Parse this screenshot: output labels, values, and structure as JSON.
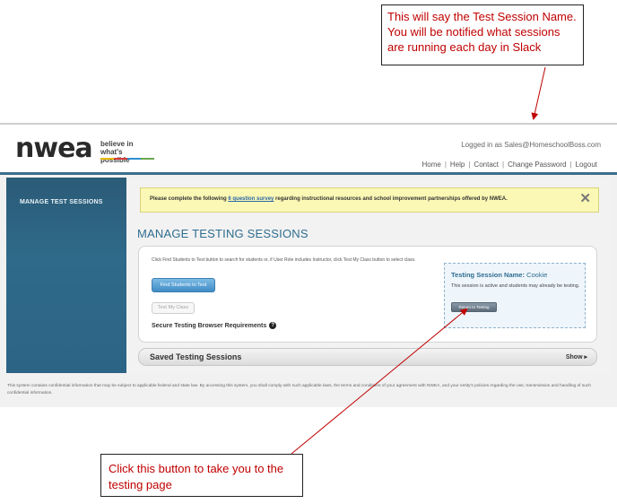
{
  "annotations": {
    "top_note": "This will say the Test Session Name. You will be notified what sessions are running each day in Slack",
    "bottom_note": "Click this button to take you to the testing page"
  },
  "header": {
    "logo_text": "nwea",
    "logo_tagline": "believe in\nwhat's possible",
    "logged_in": "Logged in as Sales@HomeschoolBoss.com",
    "links": [
      "Home",
      "Help",
      "Contact",
      "Change Password",
      "Logout"
    ],
    "separator": "|"
  },
  "sidebar": {
    "items": [
      {
        "label": "MANAGE TEST SESSIONS"
      }
    ]
  },
  "survey_banner": {
    "prefix": "Please complete the following ",
    "link": "6 question survey",
    "suffix": " regarding instructional resources and school improvement partnerships offered by NWEA.",
    "close": "✕"
  },
  "main": {
    "title": "MANAGE TESTING SESSIONS",
    "instructions": "Click Find Students to Test button to search for students or, if User Role includes Instructor, click Test My Class button to select class.",
    "find_button": "Find Students to Test",
    "test_class_button": "Test My Class",
    "secure_link": "Secure Testing Browser Requirements",
    "help_glyph": "?"
  },
  "session": {
    "label": "Testing Session Name:",
    "name": "Cookie",
    "description": "This session is active and students may already be testing.",
    "return_button": "Return to Testing"
  },
  "saved_sessions": {
    "title": "Saved Testing Sessions",
    "toggle": "Show",
    "toggle_icon": "▸"
  },
  "footer": {
    "text": "This system contains confidential information that may be subject to applicable federal and state law. By accessing this system, you shall comply with such applicable laws, the terms and conditions of your agreement with NWEA, and your entity's policies regarding the use, transmission and handling of such confidential information."
  },
  "colors": {
    "accent_blue": "#2f6d8f",
    "annotation_red": "#c00000",
    "sidebar": "#2b5b77",
    "banner": "#fbf8b5"
  }
}
